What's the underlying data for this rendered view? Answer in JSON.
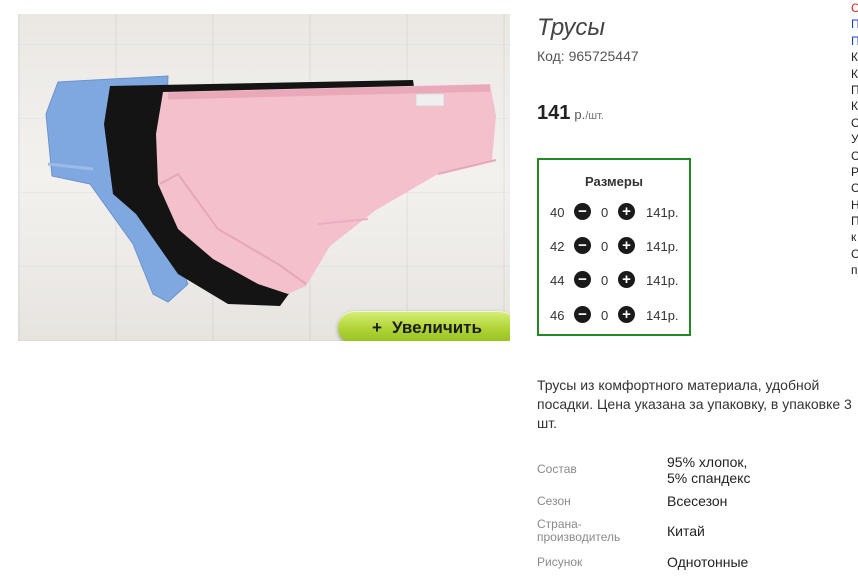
{
  "product": {
    "title": "Трусы",
    "code": "Код: 965725447",
    "price": "141",
    "currency": "р.",
    "per_unit": "/шт.",
    "zoom_button_label": "Увеличить",
    "zoom_icon": "+",
    "description": "Трусы из комфортного материала, удобной посадки. Цена указана за упаковку, в упаковке 3 шт."
  },
  "sizes": {
    "title": "Размеры",
    "rows": [
      {
        "size": "40",
        "qty": "0",
        "price": "141р."
      },
      {
        "size": "42",
        "qty": "0",
        "price": "141р."
      },
      {
        "size": "44",
        "qty": "0",
        "price": "141р."
      },
      {
        "size": "46",
        "qty": "0",
        "price": "141р."
      }
    ],
    "minus_icon": "minus-icon",
    "plus_icon": "plus-icon"
  },
  "properties": [
    {
      "key": "Состав",
      "value": "95% хлопок, 5% спандекс"
    },
    {
      "key": "Сезон",
      "value": "Всесезон"
    },
    {
      "key": "Страна-производитель",
      "value": "Китай"
    },
    {
      "key": "Рисунок",
      "value": "Однотонные"
    }
  ],
  "side_column": [
    "С",
    "П",
    "П",
    "К",
    "К",
    "П",
    "К",
    "С",
    "У",
    "С",
    "Р",
    "С",
    "Н",
    "П",
    "к",
    "С",
    "п"
  ],
  "colors": {
    "accent_border": "#1f8a1f",
    "zoom_button": "#b3d63a",
    "side_red": "#d22222",
    "side_blue": "#1a3fcf"
  }
}
